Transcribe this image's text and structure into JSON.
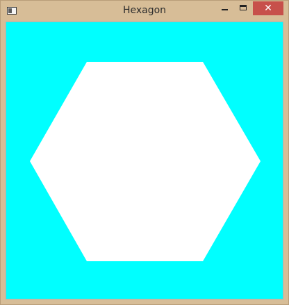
{
  "window": {
    "title": "Hexagon",
    "frame_color": "#D7BD97",
    "controls": {
      "minimize_icon": "minimize-icon",
      "maximize_icon": "maximize-icon",
      "close_icon": "close-icon",
      "close_glyph": "✕",
      "close_color": "#C7504B"
    }
  },
  "canvas": {
    "background_color": "#00FFFF",
    "shape": {
      "type": "hexagon",
      "fill_color": "#FFFFFF"
    }
  }
}
